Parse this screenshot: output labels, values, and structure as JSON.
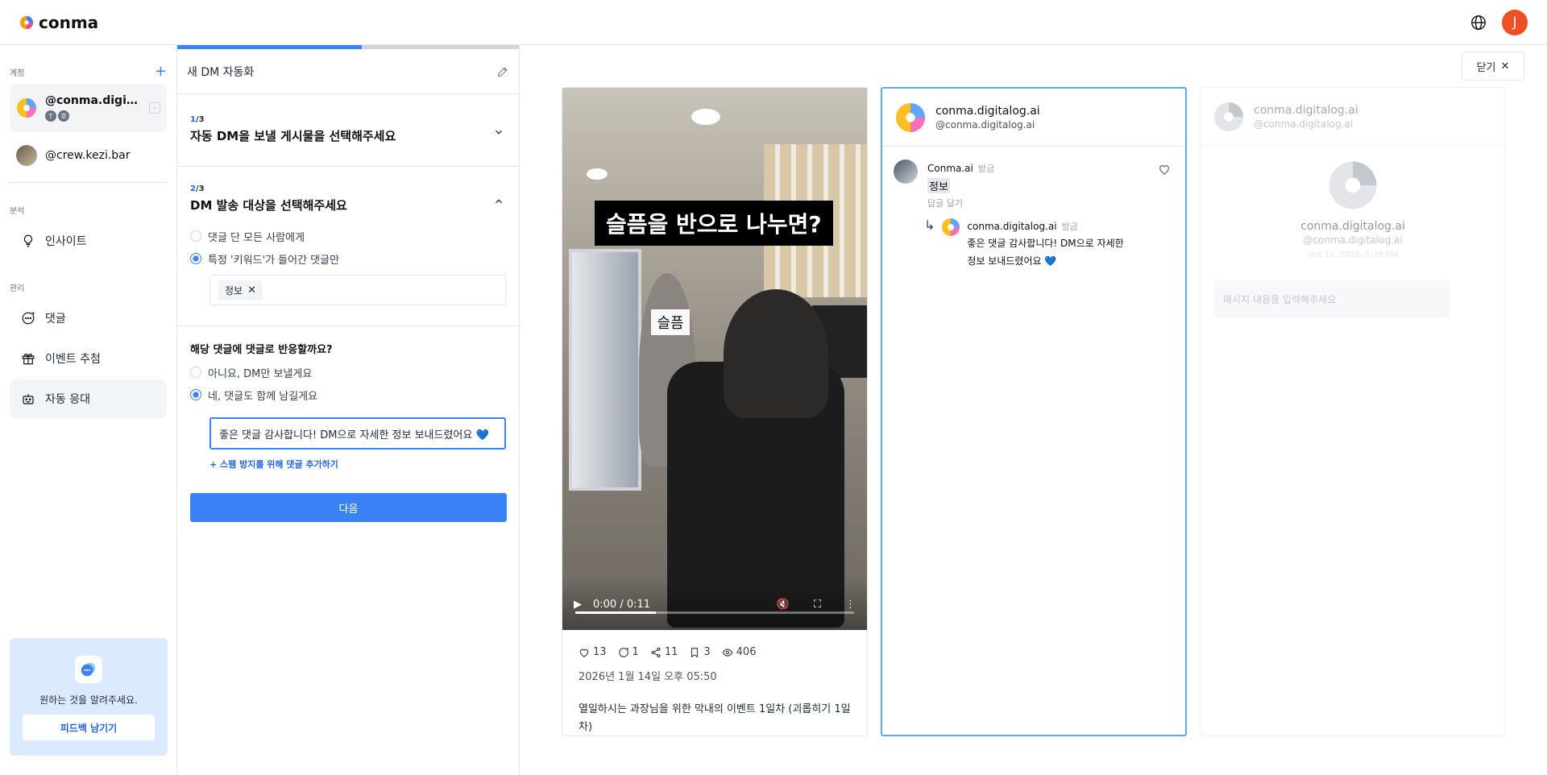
{
  "app": {
    "brand": "conma",
    "user_initial": "J"
  },
  "sidebar": {
    "accounts_label": "계정",
    "accounts": [
      {
        "handle": "@conma.digital...",
        "chips": [
          "T",
          "후"
        ]
      },
      {
        "handle": "@crew.kezi.bar"
      }
    ],
    "analysis_label": "분석",
    "insight": "인사이트",
    "manage_label": "관리",
    "items": [
      {
        "label": "댓글"
      },
      {
        "label": "이벤트 추첨"
      },
      {
        "label": "자동 응대"
      }
    ],
    "feedback": {
      "text": "원하는 것을 알려주세요.",
      "button": "피드백 남기기"
    }
  },
  "panel": {
    "progress_percent": 54,
    "title": "새 DM 자동화",
    "step1": {
      "num": "1",
      "total": "/3",
      "title": "자동 DM을 보낼 게시물을 선택해주세요"
    },
    "step2": {
      "num": "2",
      "total": "/3",
      "title": "DM 발송 대상을 선택해주세요",
      "option_all": "댓글 단 모든 사람에게",
      "option_keyword": "특정 '키워드'가 들어간 댓글만",
      "keyword_tag": "정보"
    },
    "reply": {
      "question": "해당 댓글에 댓글로 반응할까요?",
      "option_no": "아니요, DM만 보낼게요",
      "option_yes": "네, 댓글도 함께 남길게요",
      "input_value": "좋은 댓글 감사합니다! DM으로 자세한 정보 보내드렸어요 💙",
      "add_link": "+ 스팸 방지를 위해 댓글 추가하기"
    },
    "next_button": "다음"
  },
  "close_button": "닫기",
  "post": {
    "video_caption": "슬픔을 반으로 나누면?",
    "sign_text": "슬픔",
    "video_time": "0:00 / 0:11",
    "video_progress": 0.29,
    "likes": "13",
    "comments": "1",
    "shares": "11",
    "saves": "3",
    "views": "406",
    "date": "2026년 1월 14일 오후 05:50",
    "description": "열일하시는 과장님을 위한 막내의 이벤트 1일차 (괴롭히기 1일차)"
  },
  "comment_preview": {
    "account_name": "conma.digitalog.ai",
    "account_handle": "@conma.digitalog.ai",
    "comment_author": "Conma.ai",
    "comment_time": "방금",
    "comment_text": "정보",
    "reply_label": "답글 달기",
    "reply_author": "conma.digitalog.ai",
    "reply_time": "방금",
    "reply_text": "좋은 댓글 감사합니다! DM으로 자세한 정보 보내드렸어요 💙"
  },
  "dm_preview": {
    "account_name": "conma.digitalog.ai",
    "account_handle": "@conma.digitalog.ai",
    "center_name": "conma.digitalog.ai",
    "center_handle": "@conma.digitalog.ai",
    "center_date": "Oct 11, 2025, 1:19 PM",
    "input_placeholder": "메시지 내용을 입력해주세요"
  },
  "colors": {
    "accent": "#3b82f6",
    "avatar": "#f04e23"
  }
}
